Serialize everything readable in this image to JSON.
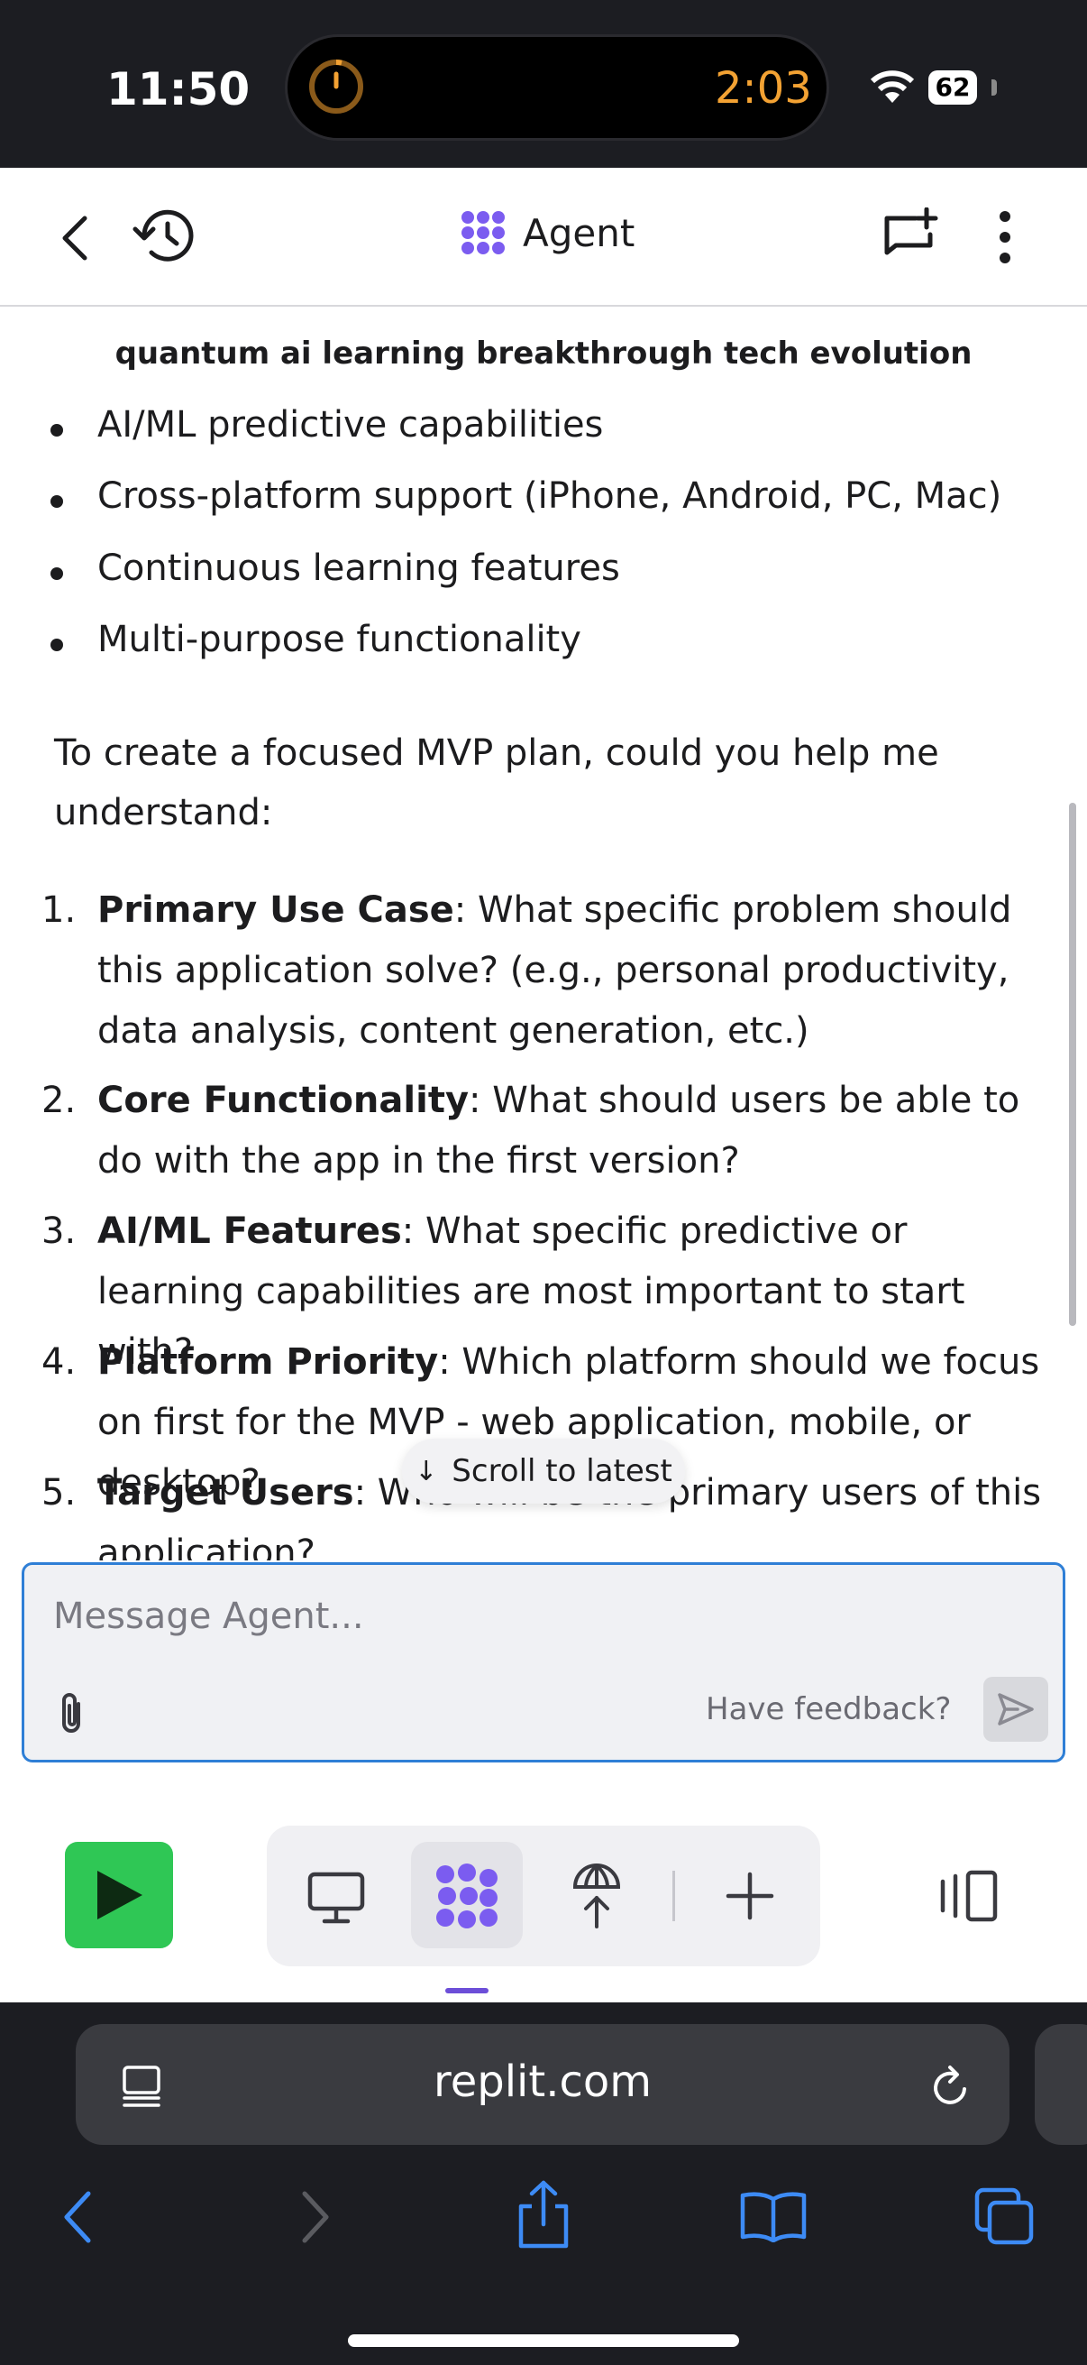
{
  "status_bar": {
    "time": "11:50",
    "timer": "2:03",
    "battery": "62"
  },
  "header": {
    "title": "Agent",
    "icons": [
      "back-icon",
      "history-icon",
      "agent-logo-icon",
      "new-chat-icon",
      "more-icon"
    ]
  },
  "chat": {
    "title": "quantum ai learning breakthrough tech evolution",
    "bullets": [
      "AI/ML predictive capabilities",
      "Cross-platform support (iPhone, Android, PC, Mac)",
      "Continuous learning features",
      "Multi-purpose functionality"
    ],
    "intro": "To create a focused MVP plan, could you help me understand:",
    "questions": [
      {
        "num": "1.",
        "label": "Primary Use Case",
        "text": ": What specific problem should this application solve? (e.g., personal productivity, data analysis, content generation, etc.)"
      },
      {
        "num": "2.",
        "label": "Core Functionality",
        "text": ": What should users be able to do with the app in the first version?"
      },
      {
        "num": "3.",
        "label": "AI/ML Features",
        "text": ": What specific predictive or learning capabilities are most important to start with?"
      },
      {
        "num": "4.",
        "label": "Platform Priority",
        "text": ": Which platform should we focus on first for the MVP - web application, mobile, or desktop?"
      },
      {
        "num": "5.",
        "label": "Target Users",
        "text": ": Who will be the primary users of this application?"
      }
    ],
    "scroll_to_latest": "Scroll to latest"
  },
  "composer": {
    "placeholder": "Message Agent...",
    "feedback": "Have feedback?"
  },
  "toolbar": {
    "icons": [
      "run-icon",
      "preview-icon",
      "agent-icon",
      "deploy-icon",
      "add-icon",
      "layout-icon"
    ],
    "run_color": "#2fc755",
    "accent": "#7b5cf0"
  },
  "browser": {
    "url": "replit.com",
    "icons": [
      "tab-page-icon",
      "reload-icon",
      "back-icon",
      "forward-icon",
      "share-icon",
      "bookmarks-icon",
      "tabs-icon"
    ]
  }
}
